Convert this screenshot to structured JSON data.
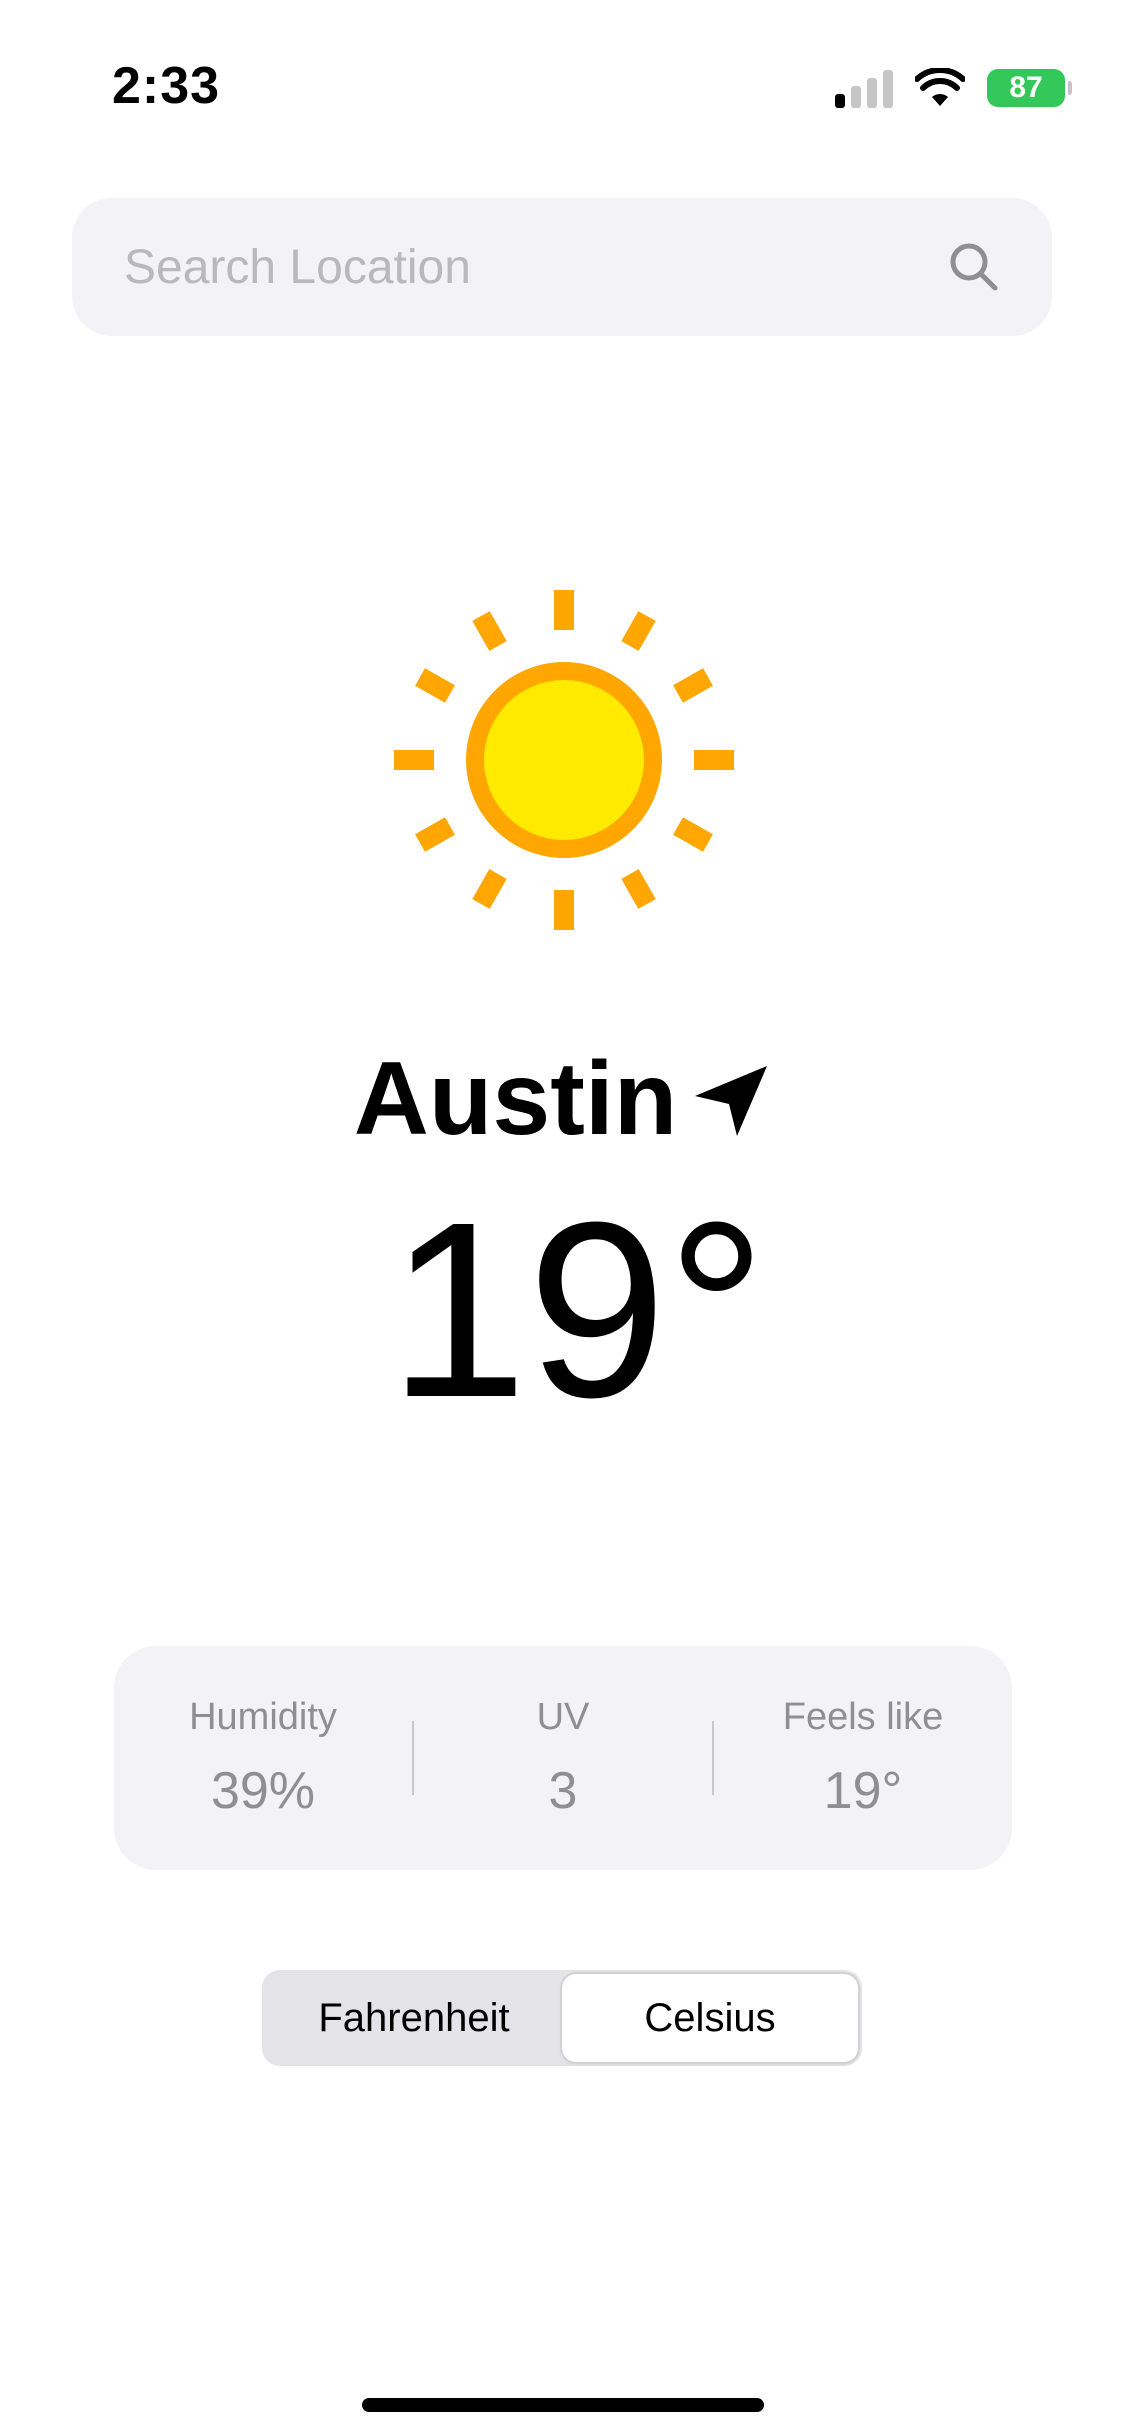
{
  "status_bar": {
    "time": "2:33",
    "battery": "87"
  },
  "search": {
    "placeholder": "Search Location",
    "value": ""
  },
  "weather": {
    "icon": "sun-icon",
    "city": "Austin",
    "temperature": "19°"
  },
  "stats": {
    "humidity_label": "Humidity",
    "humidity_value": "39%",
    "uv_label": "UV",
    "uv_value": "3",
    "feels_like_label": "Feels like",
    "feels_like_value": "19°"
  },
  "units": {
    "fahrenheit_label": "Fahrenheit",
    "celsius_label": "Celsius",
    "selected": "Celsius"
  },
  "colors": {
    "battery": "#34c759",
    "card_background": "#f2f2f7",
    "sun_core": "#ffea00",
    "sun_ring": "#ffa600"
  }
}
